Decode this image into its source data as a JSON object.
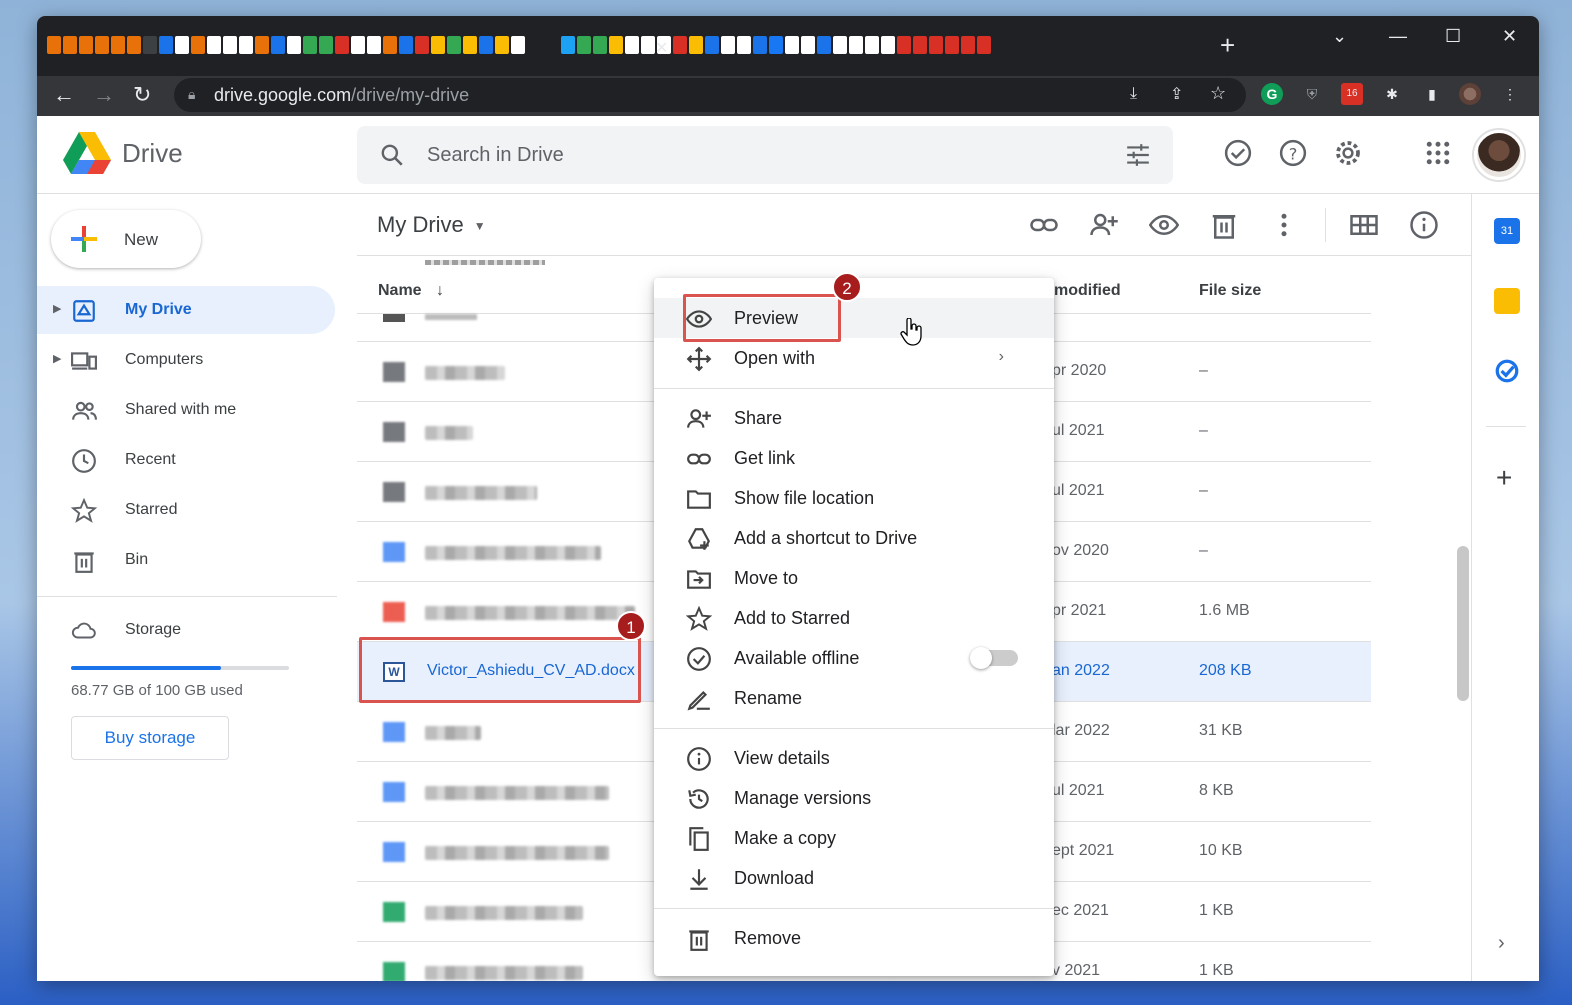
{
  "browser": {
    "url_host": "drive.google.com",
    "url_path": "/drive/my-drive",
    "new_tab": "+",
    "ext_badge": "16",
    "favicon_colors": [
      "#e8710a",
      "#e8710a",
      "#e8710a",
      "#e8710a",
      "#e8710a",
      "#e8710a",
      "#3c4043",
      "#1a73e8",
      "#ffffff",
      "#e8710a",
      "#ffffff",
      "#ffffff",
      "#ffffff",
      "#e8710a",
      "#1a73e8",
      "#ffffff",
      "#34a853",
      "#34a853",
      "#d93025",
      "#ffffff",
      "#ffffff",
      "#e8710a",
      "#1a73e8",
      "#d93025",
      "#fbbc04",
      "#34a853",
      "#fbbc04",
      "#1a73e8",
      "#fbbc04",
      "#ffffff",
      "#1da1f2",
      "#34a853",
      "#34a853",
      "#fbbc04",
      "#ffffff",
      "#ffffff",
      "#ffffff",
      "#d93025",
      "#fbbc04",
      "#1a73e8",
      "#ffffff",
      "#ffffff",
      "#1a73e8",
      "#1877f2",
      "#ffffff",
      "#ffffff",
      "#1a73e8",
      "#ffffff",
      "#ffffff",
      "#ffffff",
      "#ffffff",
      "#d93025",
      "#d93025",
      "#d93025",
      "#d93025",
      "#d93025",
      "#d93025"
    ]
  },
  "app": {
    "brand": "Drive",
    "search_placeholder": "Search in Drive"
  },
  "sidebar": {
    "new_label": "New",
    "items": [
      {
        "label": "My Drive",
        "icon": "my-drive-icon",
        "active": true
      },
      {
        "label": "Computers",
        "icon": "computers-icon"
      },
      {
        "label": "Shared with me",
        "icon": "shared-icon"
      },
      {
        "label": "Recent",
        "icon": "clock-icon"
      },
      {
        "label": "Starred",
        "icon": "star-icon"
      },
      {
        "label": "Bin",
        "icon": "bin-icon"
      }
    ],
    "storage_label": "Storage",
    "storage_used_fraction": 0.6877,
    "storage_text": "68.77 GB of 100 GB used",
    "buy_storage": "Buy storage"
  },
  "main": {
    "breadcrumb": "My Drive",
    "columns": {
      "name": "Name",
      "modified": "modified",
      "size": "File size"
    },
    "rows": [
      {
        "type": "folder",
        "date": "pr 2020",
        "size": "–"
      },
      {
        "type": "folder",
        "date": "ul 2021",
        "size": "–"
      },
      {
        "type": "folder",
        "date": "ul 2021",
        "size": "–"
      },
      {
        "type": "doc",
        "date": "ov 2020",
        "size": "–"
      },
      {
        "type": "pdf",
        "date": "pr 2021",
        "size": "1.6 MB"
      },
      {
        "type": "word",
        "name": "Victor_Ashiedu_CV_AD.docx",
        "date": "an 2022",
        "size": "208 KB",
        "selected": true
      },
      {
        "type": "doc",
        "date": "lar 2022",
        "size": "31 KB"
      },
      {
        "type": "doc",
        "date": "ul 2021",
        "size": "8 KB"
      },
      {
        "type": "doc",
        "date": "ept 2021",
        "size": "10 KB"
      },
      {
        "type": "sheet",
        "date": "ec 2021",
        "size": "1 KB"
      },
      {
        "type": "sheet",
        "date": "v 2021",
        "size": "1 KB"
      }
    ]
  },
  "context_menu": {
    "items": [
      {
        "label": "Preview",
        "icon": "eye-icon"
      },
      {
        "label": "Open with",
        "icon": "open-with-icon",
        "submenu_arrow": "›"
      },
      {
        "label": "Share",
        "icon": "person-add-icon"
      },
      {
        "label": "Get link",
        "icon": "link-icon"
      },
      {
        "label": "Show file location",
        "icon": "folder-icon"
      },
      {
        "label": "Add a shortcut to Drive",
        "icon": "shortcut-icon"
      },
      {
        "label": "Move to",
        "icon": "move-icon"
      },
      {
        "label": "Add to Starred",
        "icon": "star-icon"
      },
      {
        "label": "Available offline",
        "icon": "offline-icon"
      },
      {
        "label": "Rename",
        "icon": "pencil-icon"
      },
      {
        "label": "View details",
        "icon": "info-icon"
      },
      {
        "label": "Manage versions",
        "icon": "history-icon"
      },
      {
        "label": "Make a copy",
        "icon": "copy-icon"
      },
      {
        "label": "Download",
        "icon": "download-icon"
      },
      {
        "label": "Remove",
        "icon": "bin-icon"
      }
    ]
  },
  "annotations": {
    "step1": "1",
    "step2": "2"
  },
  "colors": {
    "accent": "#1a73e8",
    "selected_bg": "#e8f0fe",
    "annotation_red": "#d9534f",
    "badge": "#a71d1d"
  }
}
